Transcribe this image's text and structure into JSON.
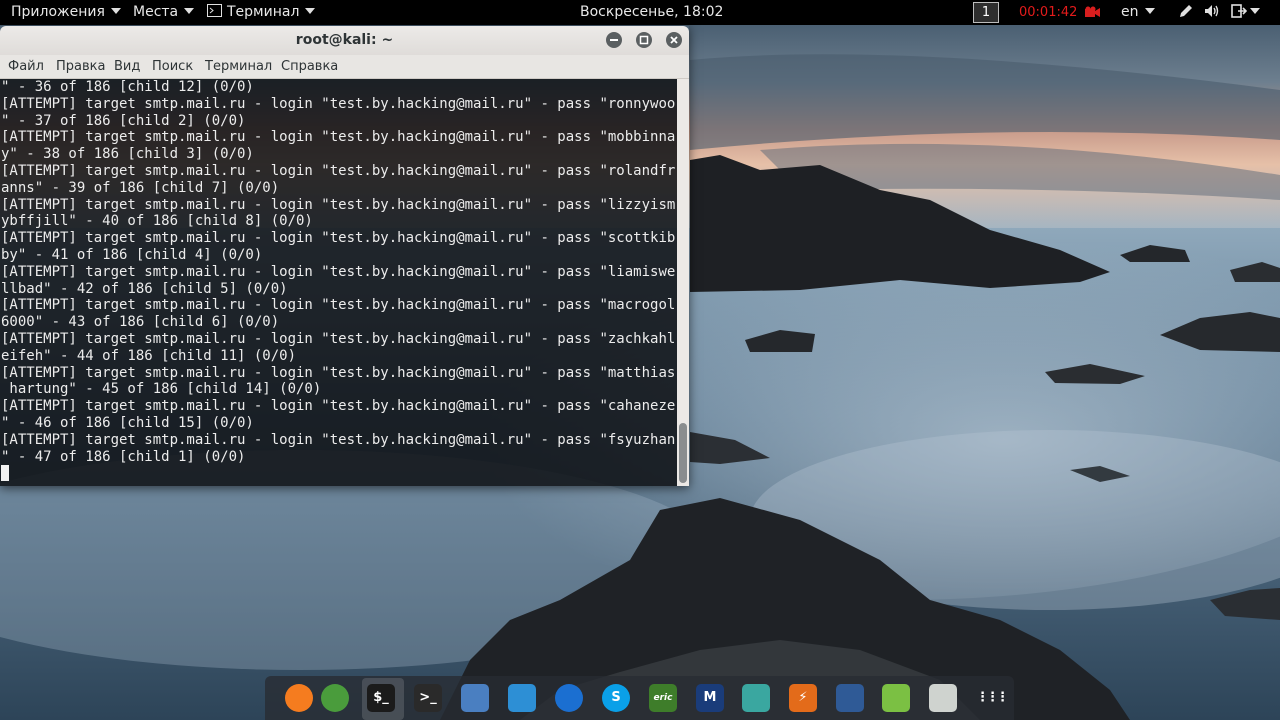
{
  "topbar": {
    "applications": "Приложения",
    "places": "Места",
    "terminal": "Терминал",
    "clock": "Воскресенье, 18:02",
    "workspace": "1",
    "recording_timer": "00:01:42",
    "language": "en",
    "icons": [
      "record-icon",
      "pen-icon",
      "volume-icon",
      "power-icon"
    ]
  },
  "terminal": {
    "title": "root@kali: ~",
    "menu": [
      "Файл",
      "Правка",
      "Вид",
      "Поиск",
      "Терминал",
      "Справка"
    ],
    "lines": [
      "\" - 36 of 186 [child 12] (0/0)",
      "[ATTEMPT] target smtp.mail.ru - login \"test.by.hacking@mail.ru\" - pass \"ronnywoo",
      "\" - 37 of 186 [child 2] (0/0)",
      "[ATTEMPT] target smtp.mail.ru - login \"test.by.hacking@mail.ru\" - pass \"mobbinna",
      "y\" - 38 of 186 [child 3] (0/0)",
      "[ATTEMPT] target smtp.mail.ru - login \"test.by.hacking@mail.ru\" - pass \"rolandfr",
      "anns\" - 39 of 186 [child 7] (0/0)",
      "[ATTEMPT] target smtp.mail.ru - login \"test.by.hacking@mail.ru\" - pass \"lizzyism",
      "ybffjill\" - 40 of 186 [child 8] (0/0)",
      "[ATTEMPT] target smtp.mail.ru - login \"test.by.hacking@mail.ru\" - pass \"scottkib",
      "by\" - 41 of 186 [child 4] (0/0)",
      "[ATTEMPT] target smtp.mail.ru - login \"test.by.hacking@mail.ru\" - pass \"liamiswe",
      "llbad\" - 42 of 186 [child 5] (0/0)",
      "[ATTEMPT] target smtp.mail.ru - login \"test.by.hacking@mail.ru\" - pass \"macrogol",
      "6000\" - 43 of 186 [child 6] (0/0)",
      "[ATTEMPT] target smtp.mail.ru - login \"test.by.hacking@mail.ru\" - pass \"zachkahl",
      "eifeh\" - 44 of 186 [child 11] (0/0)",
      "[ATTEMPT] target smtp.mail.ru - login \"test.by.hacking@mail.ru\" - pass \"matthias",
      " hartung\" - 45 of 186 [child 14] (0/0)",
      "[ATTEMPT] target smtp.mail.ru - login \"test.by.hacking@mail.ru\" - pass \"cahaneze",
      "\" - 46 of 186 [child 15] (0/0)",
      "[ATTEMPT] target smtp.mail.ru - login \"test.by.hacking@mail.ru\" - pass \"fsyuzhan",
      "\" - 47 of 186 [child 1] (0/0)"
    ]
  },
  "dock": {
    "items": [
      {
        "name": "firefox-icon",
        "color": "#f57c1f"
      },
      {
        "name": "maltego-icon",
        "color": "#4a9c3c"
      },
      {
        "name": "terminal-icon",
        "color": "#1b1b1b",
        "glyph": "$_"
      },
      {
        "name": "terminal-root-icon",
        "color": "#2a2a2a",
        "glyph": ">_"
      },
      {
        "name": "files-icon",
        "color": "#4a7fc1"
      },
      {
        "name": "system-monitor-icon",
        "color": "#2d8fd5"
      },
      {
        "name": "teamviewer-icon",
        "color": "#1b6fd1"
      },
      {
        "name": "skype-beta-icon",
        "color": "#0aa0e8",
        "glyph": "S"
      },
      {
        "name": "eric-ide-icon",
        "color": "#3e7d2a",
        "glyph": "eric"
      },
      {
        "name": "metasploit-icon",
        "color": "#1a3c7a",
        "glyph": "M"
      },
      {
        "name": "armitage-icon",
        "color": "#3aa7a0"
      },
      {
        "name": "burpsuite-icon",
        "color": "#e36b1a",
        "glyph": "⚡"
      },
      {
        "name": "wireshark-icon",
        "color": "#2f5a96"
      },
      {
        "name": "notes-icon",
        "color": "#7bc043"
      },
      {
        "name": "keyboard-icon",
        "color": "#cfd3cf"
      },
      {
        "name": "show-apps-icon",
        "color": "#3a3f45",
        "glyph": "⋮⋮⋮"
      }
    ]
  }
}
